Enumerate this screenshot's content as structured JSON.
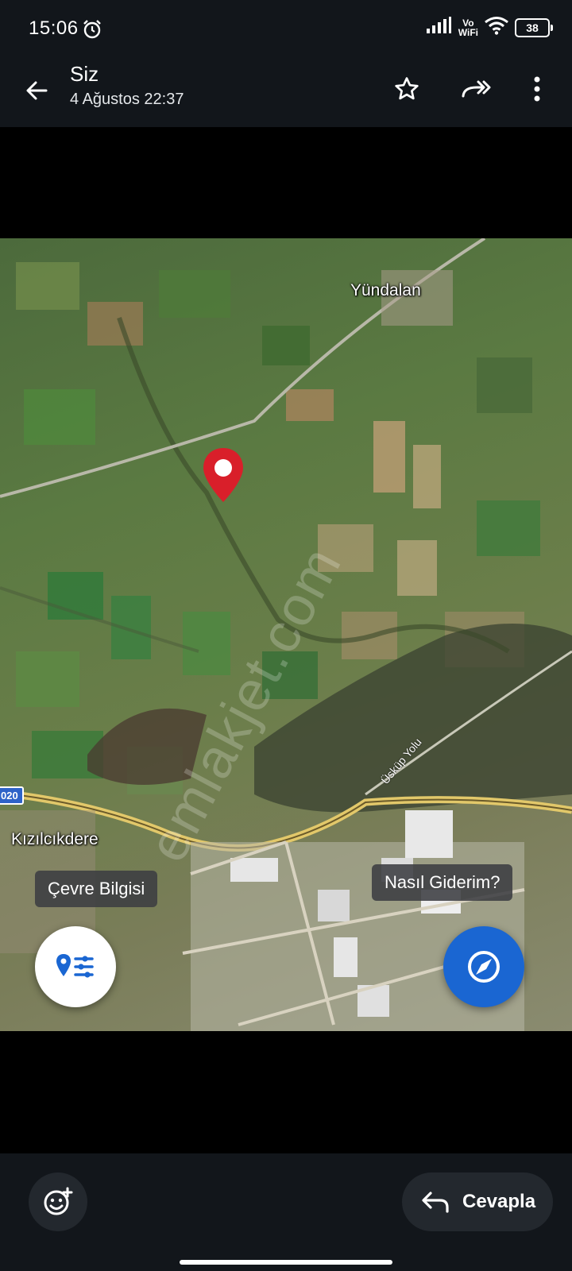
{
  "status_bar": {
    "time": "15:06",
    "vowifi_line1": "Vo",
    "vowifi_line2": "WiFi",
    "battery": "38"
  },
  "header": {
    "title": "Siz",
    "subtitle": "4 Ağustos 22:37"
  },
  "map": {
    "places": {
      "yundalan": "Yündalan",
      "kizilcikdere": "Kızılcıkdere"
    },
    "road_shield": "020",
    "road_label": "Üsküp Yolu",
    "watermark": "emlakjet.com",
    "chip_left": "Çevre Bilgisi",
    "chip_right": "Nasıl Giderim?"
  },
  "bottom": {
    "reply_label": "Cevapla"
  },
  "colors": {
    "pin": "#d91f2a",
    "fab_blue": "#1a66d2",
    "bar_bg": "#12161b"
  },
  "icons": [
    "alarm-icon",
    "signal-icon",
    "wifi-icon",
    "battery-icon",
    "back-arrow-icon",
    "star-icon",
    "forward-icon",
    "more-vert-icon",
    "map-pin-icon",
    "nearby-info-icon",
    "compass-icon",
    "emoji-add-icon",
    "reply-icon"
  ]
}
